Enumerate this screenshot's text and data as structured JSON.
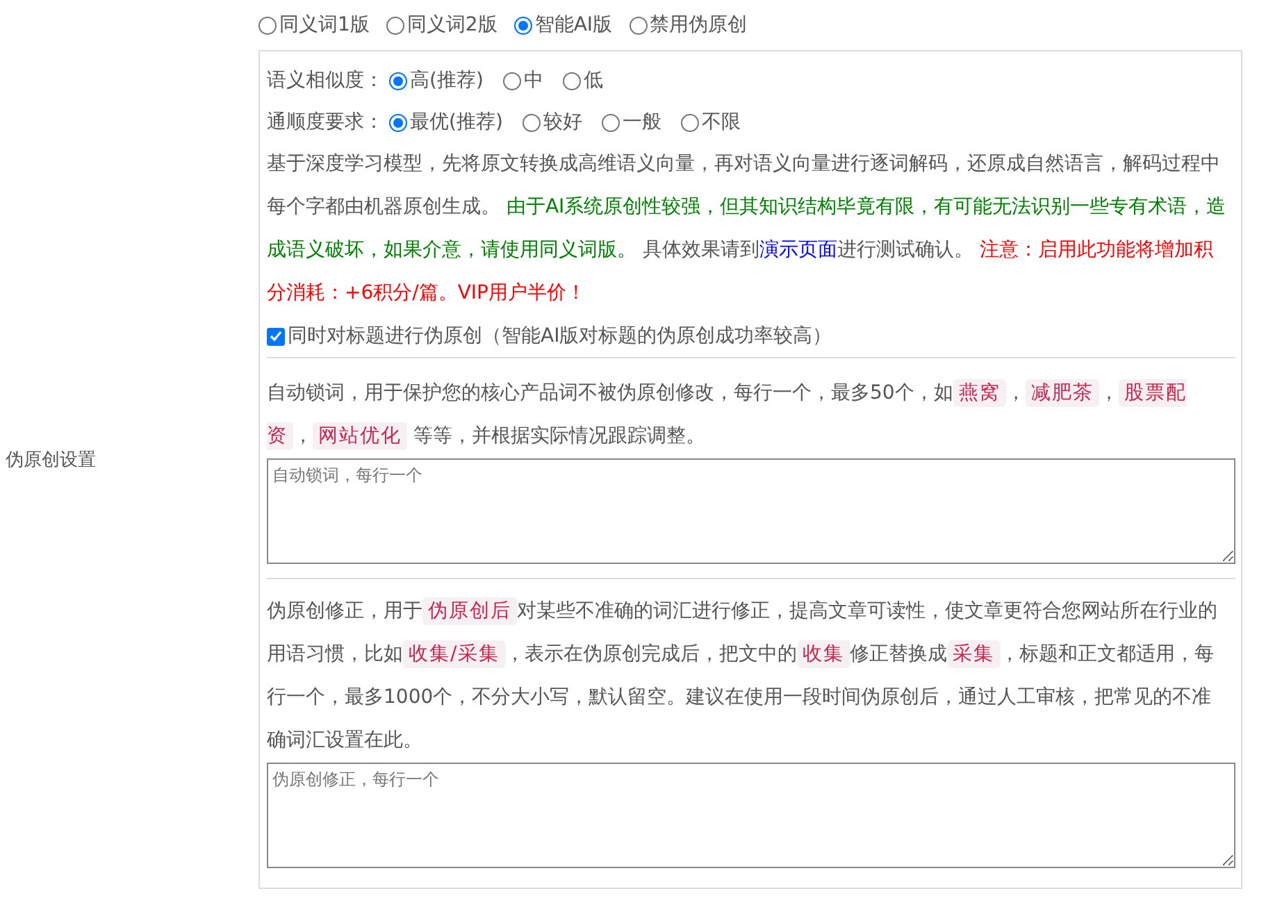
{
  "section_label": "伪原创设置",
  "modes": [
    {
      "label": "同义词1版",
      "selected": false
    },
    {
      "label": "同义词2版",
      "selected": false
    },
    {
      "label": "智能AI版",
      "selected": true
    },
    {
      "label": "禁用伪原创",
      "selected": false
    }
  ],
  "settings": [
    {
      "label": "语义相似度：",
      "options": [
        {
          "label": "高(推荐)",
          "selected": true
        },
        {
          "label": "中",
          "selected": false
        },
        {
          "label": "低",
          "selected": false
        }
      ]
    },
    {
      "label": "通顺度要求：",
      "options": [
        {
          "label": "最优(推荐)",
          "selected": true
        },
        {
          "label": "较好",
          "selected": false
        },
        {
          "label": "一般",
          "selected": false
        },
        {
          "label": "不限",
          "selected": false
        }
      ]
    }
  ],
  "ai_note": [
    {
      "kind": "plain",
      "text": "基于深度学习模型，先将原文转换成高维语义向量，再对语义向量进行逐词解码，还原成自然语言，解码过程中每个字都由机器原创生成。 "
    },
    {
      "kind": "advice",
      "text": "由于AI系统原创性较强，但其知识结构毕竟有限，有可能无法识别一些专有术语，造成语义破坏，如果介意，请使用同义词版。"
    },
    {
      "kind": "plain",
      "text": " 具体效果请到"
    },
    {
      "kind": "link",
      "text": "演示页面"
    },
    {
      "kind": "plain",
      "text": "进行测试确认。 "
    },
    {
      "kind": "warning",
      "text": "注意：启用此功能将增加积分消耗：+6积分/篇。VIP用户半价！"
    }
  ],
  "title_option": {
    "label": "同时对标题进行伪原创（智能AI版对标题的伪原创成功率较高）",
    "checked": true
  },
  "lock_words": {
    "description": [
      {
        "kind": "plain",
        "text": "自动锁词，用于保护您的核心产品词不被伪原创修改，每行一个，最多50个，如"
      },
      {
        "kind": "tag",
        "text": "燕窝"
      },
      {
        "kind": "plain",
        "text": "，"
      },
      {
        "kind": "tag",
        "text": "减肥茶"
      },
      {
        "kind": "plain",
        "text": "，"
      },
      {
        "kind": "tag",
        "text": "股票配资"
      },
      {
        "kind": "plain",
        "text": "，"
      },
      {
        "kind": "tag",
        "text": "网站优化"
      },
      {
        "kind": "plain",
        "text": " 等等，并根据实际情况跟踪调整。"
      }
    ],
    "placeholder": "自动锁词，每行一个"
  },
  "correction": {
    "description": [
      {
        "kind": "plain",
        "text": "伪原创修正，用于"
      },
      {
        "kind": "tag",
        "text": "伪原创后"
      },
      {
        "kind": "plain",
        "text": "对某些不准确的词汇进行修正，提高文章可读性，使文章更符合您网站所在行业的用语习惯，比如"
      },
      {
        "kind": "tag",
        "text": "收集/采集"
      },
      {
        "kind": "plain",
        "text": "，表示在伪原创完成后，把文中的"
      },
      {
        "kind": "tag",
        "text": "收集"
      },
      {
        "kind": "plain",
        "text": "修正替换成"
      },
      {
        "kind": "tag",
        "text": "采集"
      },
      {
        "kind": "plain",
        "text": "，标题和正文都适用，每行一个，最多1000个，不分大小写，默认留空。建议在使用一段时间伪原创后，通过人工审核，把常见的不准确词汇设置在此。"
      }
    ],
    "placeholder": "伪原创修正，每行一个"
  }
}
